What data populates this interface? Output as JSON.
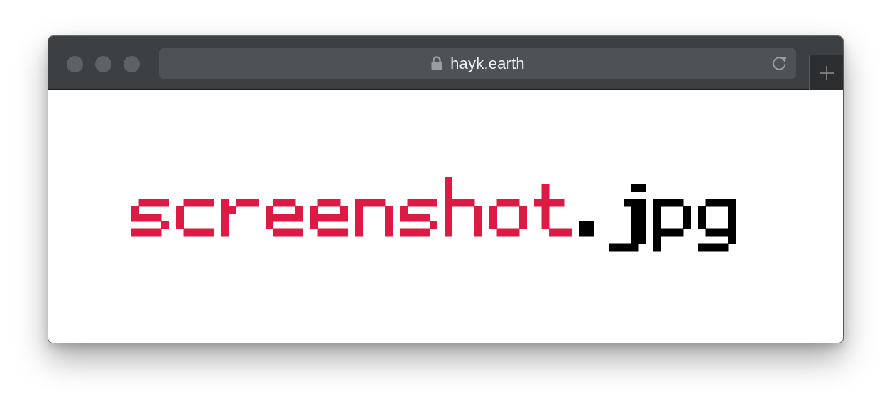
{
  "browser": {
    "url": "hayk.earth",
    "icons": {
      "lock": "lock-icon",
      "reload": "reload-icon",
      "new_tab": "plus-icon"
    },
    "colors": {
      "titlebar": "#3d4043",
      "addressbar": "#4f5254",
      "traffic_lights": "#5f6265"
    }
  },
  "page": {
    "logo": {
      "name": "screenshot",
      "extension": ".jpg",
      "name_color": "#dc1a44",
      "extension_color": "#000000"
    }
  }
}
